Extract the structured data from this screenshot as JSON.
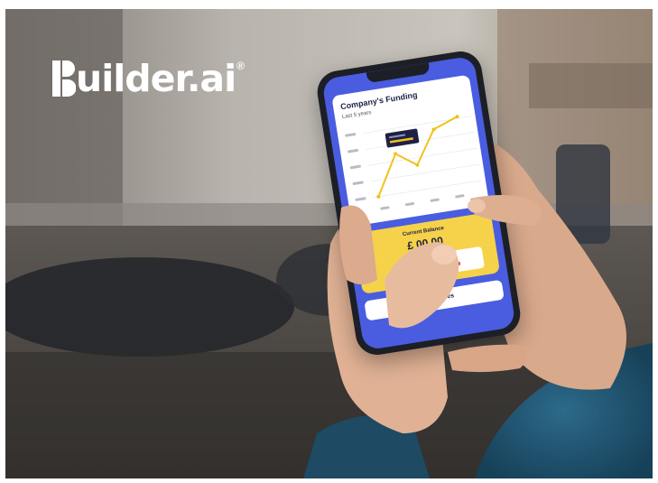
{
  "brand": {
    "logo_text": "uilder.ai",
    "registered_mark": "®"
  },
  "phone_screen": {
    "card_title": "Company's Funding",
    "card_subtitle": "Last 5 years",
    "balance_label": "Current Balance",
    "balance_value": "£           00.00",
    "button_label": "your invoices"
  },
  "colors": {
    "screen_blue": "#4a5de0",
    "card_yellow": "#f6d24a",
    "chart_line": "#f2c21a",
    "logo_white": "#ffffff"
  }
}
